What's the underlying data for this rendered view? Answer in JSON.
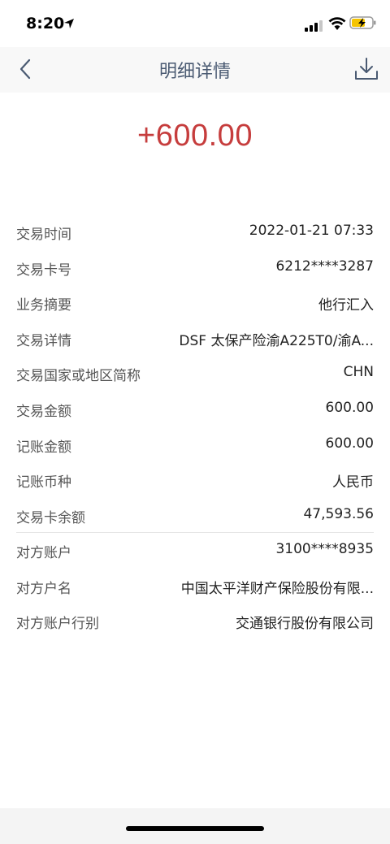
{
  "status": {
    "time": "8:20"
  },
  "nav": {
    "title": "明细详情"
  },
  "amount": "+600.00",
  "details": [
    {
      "label": "交易时间",
      "value": "2022-01-21 07:33"
    },
    {
      "label": "交易卡号",
      "value": "6212****3287"
    },
    {
      "label": "业务摘要",
      "value": "他行汇入"
    },
    {
      "label": "交易详情",
      "value": "DSF 太保产险渝A225T0/渝A..."
    },
    {
      "label": "交易国家或地区简称",
      "value": "CHN"
    },
    {
      "label": "交易金额",
      "value": "600.00"
    },
    {
      "label": "记账金额",
      "value": "600.00"
    },
    {
      "label": "记账币种",
      "value": "人民币"
    },
    {
      "label": "交易卡余额",
      "value": "47,593.56"
    }
  ],
  "counterparty": [
    {
      "label": "对方账户",
      "value": "3100****8935"
    },
    {
      "label": "对方户名",
      "value": "中国太平洋财产保险股份有限..."
    },
    {
      "label": "对方账户行别",
      "value": "交通银行股份有限公司"
    }
  ],
  "colors": {
    "amount": "#c63d3d",
    "nav_title": "#4a5a72"
  },
  "icons": [
    "location-arrow-icon",
    "signal-icon",
    "wifi-icon",
    "battery-charging-icon",
    "back-chevron-icon",
    "download-icon"
  ]
}
